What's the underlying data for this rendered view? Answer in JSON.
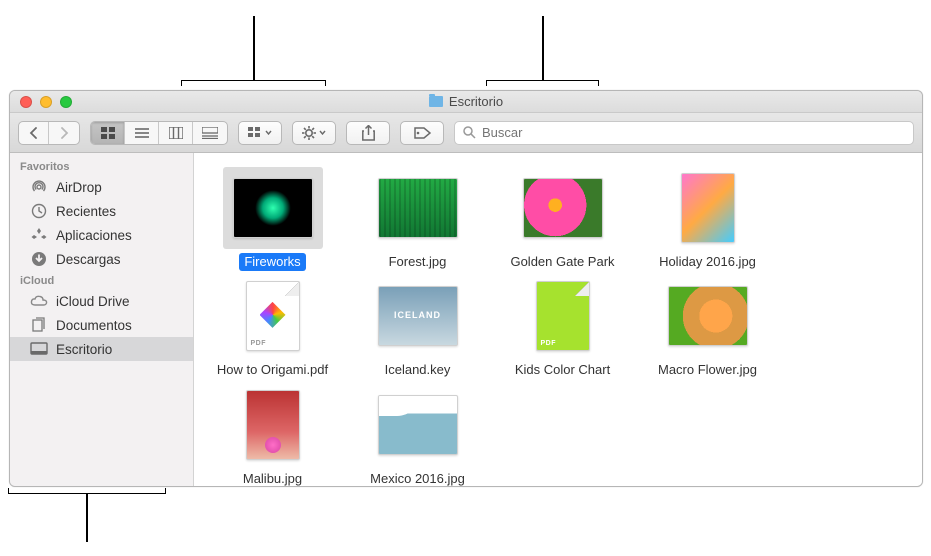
{
  "window": {
    "title": "Escritorio"
  },
  "search": {
    "placeholder": "Buscar"
  },
  "sidebar": {
    "sections": [
      {
        "header": "Favoritos",
        "items": [
          {
            "icon": "airdrop",
            "label": "AirDrop"
          },
          {
            "icon": "clock",
            "label": "Recientes"
          },
          {
            "icon": "apps",
            "label": "Aplicaciones"
          },
          {
            "icon": "download",
            "label": "Descargas"
          }
        ]
      },
      {
        "header": "iCloud",
        "items": [
          {
            "icon": "cloud",
            "label": "iCloud Drive"
          },
          {
            "icon": "docs",
            "label": "Documentos"
          },
          {
            "icon": "desktop",
            "label": "Escritorio",
            "selected": true
          }
        ]
      }
    ]
  },
  "files": [
    {
      "name": "Fireworks",
      "thumb": "fireworks",
      "selected": true
    },
    {
      "name": "Forest.jpg",
      "thumb": "forest"
    },
    {
      "name": "Golden Gate Park",
      "thumb": "flower"
    },
    {
      "name": "Holiday 2016.jpg",
      "thumb": "holiday",
      "tall": true
    },
    {
      "name": "How to Origami.pdf",
      "thumb": "origami",
      "tall": true,
      "pdf": true
    },
    {
      "name": "Iceland.key",
      "thumb": "iceland"
    },
    {
      "name": "Kids Color Chart",
      "thumb": "kids",
      "tall": true,
      "pdf": true
    },
    {
      "name": "Macro Flower.jpg",
      "thumb": "macro"
    },
    {
      "name": "Malibu.jpg",
      "thumb": "malibu",
      "tall": true
    },
    {
      "name": "Mexico 2016.jpg",
      "thumb": "mexico"
    }
  ]
}
